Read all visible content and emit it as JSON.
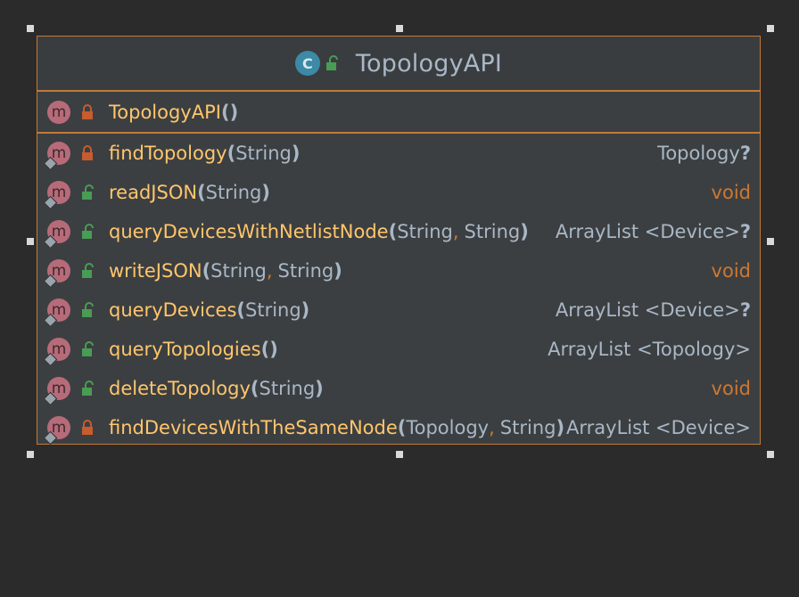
{
  "class_name": "TopologyAPI",
  "class_kind_letter": "C",
  "method_letter": "m",
  "colors": {
    "border": "#c07a3a",
    "method_name": "#ffc66d",
    "type": "#a9b7c6",
    "keyword": "#cc7832",
    "private_lock": "#c75c2e",
    "public_lock": "#499c54"
  },
  "constructor": {
    "name": "TopologyAPI",
    "visibility": "private",
    "params": [],
    "return_type": ""
  },
  "methods": [
    {
      "name": "findTopology",
      "visibility": "private",
      "params": [
        "String"
      ],
      "return_type": "Topology",
      "nullable": "?"
    },
    {
      "name": "readJSON",
      "visibility": "public",
      "params": [
        "String"
      ],
      "return_type": "void",
      "nullable": ""
    },
    {
      "name": "queryDevicesWithNetlistNode",
      "visibility": "public",
      "params": [
        "String",
        "String"
      ],
      "return_type": "ArrayList <Device>",
      "nullable": "?"
    },
    {
      "name": "writeJSON",
      "visibility": "public",
      "params": [
        "String",
        "String"
      ],
      "return_type": "void",
      "nullable": ""
    },
    {
      "name": "queryDevices",
      "visibility": "public",
      "params": [
        "String"
      ],
      "return_type": "ArrayList <Device>",
      "nullable": "?"
    },
    {
      "name": "queryTopologies",
      "visibility": "public",
      "params": [],
      "return_type": "ArrayList <Topology>",
      "nullable": ""
    },
    {
      "name": "deleteTopology",
      "visibility": "public",
      "params": [
        "String"
      ],
      "return_type": "void",
      "nullable": ""
    },
    {
      "name": "findDevicesWithTheSameNode",
      "visibility": "private",
      "params": [
        "Topology",
        "String"
      ],
      "return_type": "ArrayList <Device>",
      "nullable": ""
    }
  ]
}
